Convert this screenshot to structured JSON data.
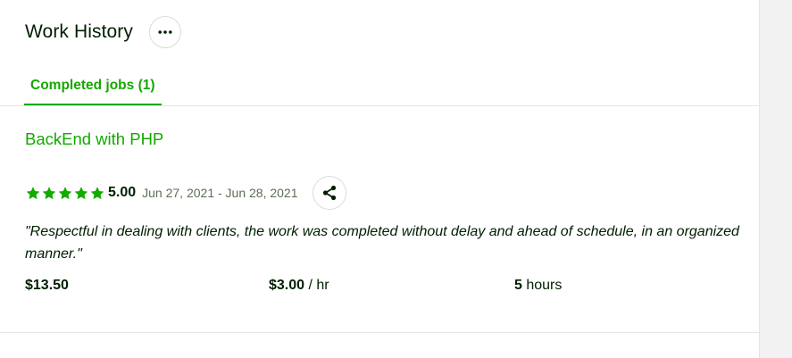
{
  "section": {
    "title": "Work History",
    "more_icon": "ellipsis-icon"
  },
  "tabs": [
    {
      "label": "Completed jobs (1)",
      "active": true
    }
  ],
  "job": {
    "title": "BackEnd with PHP",
    "rating": {
      "value": 5,
      "max": 5,
      "label": "5.00"
    },
    "dates": "Jun 27, 2021 - Jun 28, 2021",
    "share_icon": "share-icon",
    "feedback": "\"Respectful in dealing with clients, the work was completed without delay and ahead of schedule, in an organized manner.\"",
    "earnings": "$13.50",
    "rate_value": "$3.00",
    "rate_unit": " / hr",
    "hours_value": "5",
    "hours_unit": " hours"
  },
  "colors": {
    "accent": "#14a800",
    "text": "#001e00",
    "muted": "#5e6d55",
    "border": "#e4e5e7"
  }
}
